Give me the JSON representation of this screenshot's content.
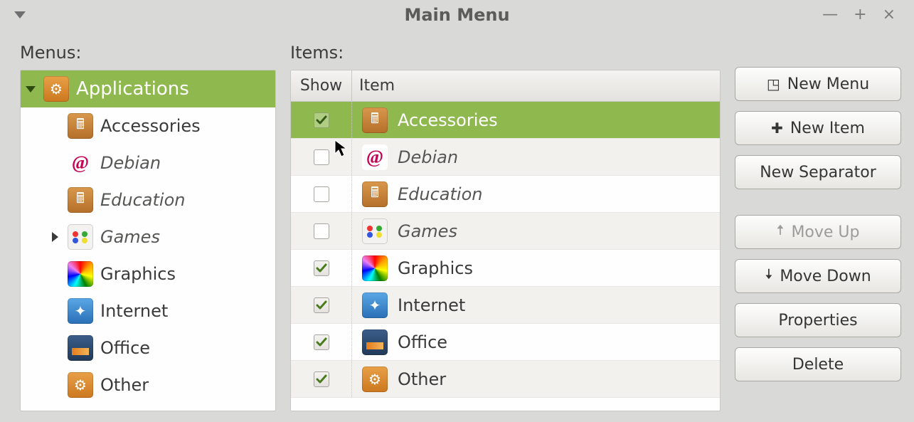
{
  "window": {
    "title": "Main Menu"
  },
  "labels": {
    "menus": "Menus:",
    "items": "Items:"
  },
  "columns": {
    "show": "Show",
    "item": "Item"
  },
  "tree": {
    "root": {
      "label": "Applications",
      "icon": "settings",
      "expanded": true
    },
    "children": [
      {
        "label": "Accessories",
        "icon": "accessories",
        "italic": false,
        "expander": false
      },
      {
        "label": "Debian",
        "icon": "debian",
        "italic": true,
        "expander": false
      },
      {
        "label": "Education",
        "icon": "education",
        "italic": true,
        "expander": false
      },
      {
        "label": "Games",
        "icon": "games",
        "italic": true,
        "expander": true
      },
      {
        "label": "Graphics",
        "icon": "graphics",
        "italic": false,
        "expander": false
      },
      {
        "label": "Internet",
        "icon": "internet",
        "italic": false,
        "expander": false
      },
      {
        "label": "Office",
        "icon": "office",
        "italic": false,
        "expander": false
      },
      {
        "label": "Other",
        "icon": "other",
        "italic": false,
        "expander": false
      }
    ]
  },
  "items": [
    {
      "label": "Accessories",
      "icon": "accessories",
      "checked": true,
      "italic": false,
      "selected": true
    },
    {
      "label": "Debian",
      "icon": "debian",
      "checked": false,
      "italic": true,
      "selected": false
    },
    {
      "label": "Education",
      "icon": "education",
      "checked": false,
      "italic": true,
      "selected": false
    },
    {
      "label": "Games",
      "icon": "games",
      "checked": false,
      "italic": true,
      "selected": false
    },
    {
      "label": "Graphics",
      "icon": "graphics",
      "checked": true,
      "italic": false,
      "selected": false
    },
    {
      "label": "Internet",
      "icon": "internet",
      "checked": true,
      "italic": false,
      "selected": false
    },
    {
      "label": "Office",
      "icon": "office",
      "checked": true,
      "italic": false,
      "selected": false
    },
    {
      "label": "Other",
      "icon": "other",
      "checked": true,
      "italic": false,
      "selected": false
    }
  ],
  "buttons": {
    "new_menu": "New Menu",
    "new_item": "New Item",
    "new_separator": "New Separator",
    "move_up": "Move Up",
    "move_down": "Move Down",
    "properties": "Properties",
    "delete": "Delete"
  }
}
